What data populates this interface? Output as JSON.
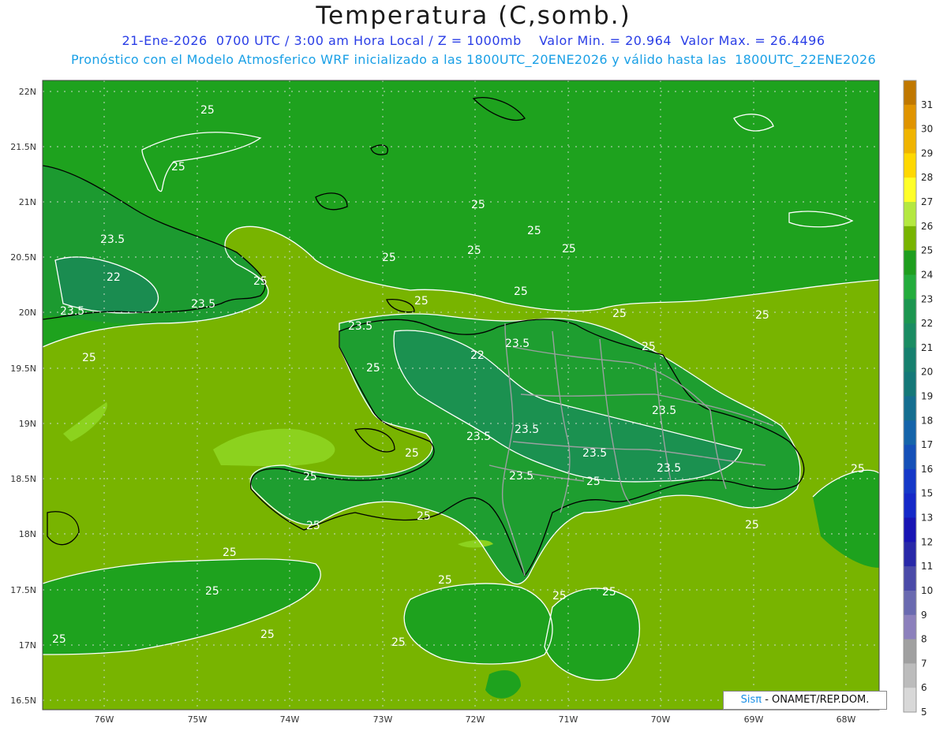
{
  "header": {
    "title": "Temperatura (C,somb.)",
    "line1": "21-Ene-2026  0700 UTC / 3:00 am Hora Local / Z = 1000mb    Valor Min. = 20.964  Valor Max. = 26.4496",
    "line2": "Pronóstico con el Modelo Atmosferico WRF inicializado a las 1800UTC_20ENE2026 y válido hasta las  1800UTC_22ENE2026"
  },
  "axes": {
    "lat_labels": [
      "22N",
      "21.5N",
      "21N",
      "20.5N",
      "20N",
      "19.5N",
      "19N",
      "18.5N",
      "18N",
      "17.5N",
      "17N",
      "16.5N"
    ],
    "lon_labels": [
      "76W",
      "75W",
      "74W",
      "73W",
      "72W",
      "71W",
      "70W",
      "69W",
      "68W"
    ]
  },
  "contour_labels": [
    "25",
    "25",
    "25",
    "25",
    "25",
    "25",
    "25",
    "25",
    "25",
    "25",
    "25",
    "25",
    "25",
    "25",
    "25",
    "25",
    "25",
    "25",
    "25",
    "25",
    "25",
    "25",
    "25",
    "25",
    "25",
    "25",
    "25",
    "25",
    "25",
    "25",
    "23.5",
    "23.5",
    "23.5",
    "23.5",
    "23.5",
    "23.5",
    "23.5",
    "23.5",
    "23.5",
    "23.5",
    "23.5",
    "22",
    "22"
  ],
  "colorbar": {
    "labels": [
      "31",
      "30",
      "29",
      "28",
      "27",
      "26",
      "25",
      "24",
      "23",
      "22",
      "21",
      "20",
      "19",
      "18",
      "17",
      "16",
      "15",
      "13",
      "12",
      "11",
      "10",
      "9",
      "8",
      "7",
      "6",
      "5"
    ],
    "colors": [
      "#c07800",
      "#e09400",
      "#f0b400",
      "#ffd800",
      "#ffff28",
      "#b4e840",
      "#78b400",
      "#1e9e1e",
      "#23ac3c",
      "#1c9650",
      "#1a8c62",
      "#16806e",
      "#147878",
      "#146e90",
      "#1464aa",
      "#1450b8",
      "#1438c8",
      "#1428c8",
      "#1814b4",
      "#2828a8",
      "#4a4aa8",
      "#6a6ab0",
      "#8c80bc",
      "#a0a0a0",
      "#bcbcbc",
      "#d8d8d8"
    ]
  },
  "credit": {
    "sis": "Sisπ",
    "text": "- ONAMET/REP.DOM."
  }
}
